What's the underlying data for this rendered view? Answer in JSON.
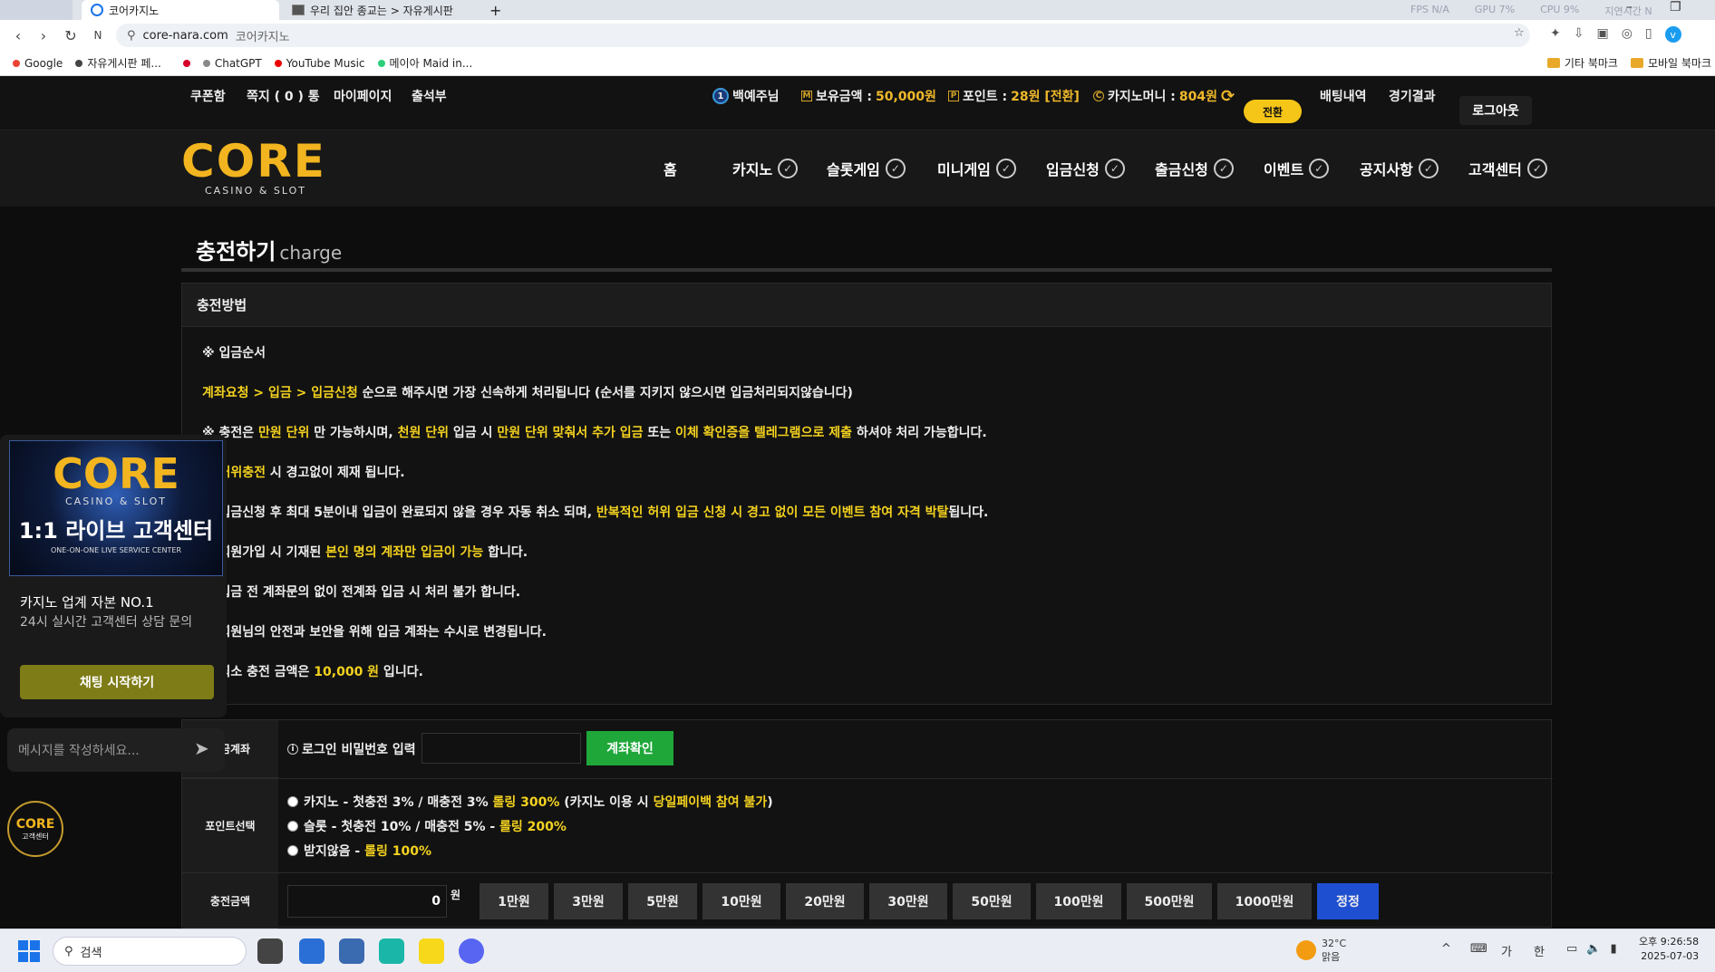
{
  "browser": {
    "tabs": [
      {
        "label": "코어카지노",
        "active": true
      },
      {
        "label": "우리 집안 종교는 > 자유게시판"
      }
    ],
    "new_tab": "+",
    "url": "core-nara.com",
    "url_title": "코어카지노",
    "bookmarks": [
      "Google",
      "자유게시판 페...",
      "ChatGPT",
      "YouTube Music",
      "메이아 Maid in..."
    ],
    "bookmark_folders": [
      "기타 북마크",
      "모바일 북마크"
    ],
    "overlay": {
      "fps": "FPS N/A",
      "gpu": "GPU 7%",
      "cpu": "CPU 9%",
      "latency": "지연시간 N"
    }
  },
  "topbar": {
    "links": [
      "쿠폰함",
      "쪽지 ( 0 ) 통",
      "마이페이지",
      "출석부"
    ],
    "user_level": "1",
    "user_name": "백예주님",
    "balance_label": "보유금액 : ",
    "balance_value": "50,000원",
    "points_label": "포인트 : ",
    "points_value": "28원 [전환]",
    "casino_money_label": "카지노머니 : ",
    "casino_money_value": "804원",
    "swap_button": "전환",
    "bet_history": "배팅내역",
    "match_results": "경기결과",
    "logout": "로그아웃"
  },
  "brand": {
    "logo_text": "CORE",
    "logo_sub": "CASINO & SLOT"
  },
  "nav": {
    "items": [
      "홈",
      "카지노",
      "슬롯게임",
      "미니게임",
      "입금신청",
      "출금신청",
      "이벤트",
      "공지사항",
      "고객센터"
    ]
  },
  "page": {
    "title": "충전하기",
    "title_en": "charge"
  },
  "guide": {
    "header": "충전방법",
    "l1": "※ 입금순서",
    "l2a": "계좌요청 > 입금 > 입금신청",
    "l2b": " 순으로 해주시면 가장 신속하게 처리됩니다 (순서를 지키지 않으시면 입금처리되지않습니다)",
    "l3a": "※ 충전은 ",
    "l3b": "만원 단위",
    "l3c": " 만 가능하시며, ",
    "l3d": "천원 단위",
    "l3e": " 입금 시 ",
    "l3f": "만원 단위 맞춰서 추가 입금",
    "l3g": " 또는 ",
    "l3h": "이체 확인증을 텔레그램으로 제출",
    "l3i": " 하셔야 처리 가능합니다.",
    "l4a": "※ 허위충전",
    "l4b": " 시 경고없이 제재 됩니다.",
    "l5a": "※ 입금신청 후 최대 5분이내 입금이 완료되지 않을 경우 자동 취소 되며, ",
    "l5b": "반복적인 허위 입금 신청 시 경고 없이 모든 이벤트 참여 자격 박탈",
    "l5c": "됩니다.",
    "l6a": "※ 회원가입 시 기재된 ",
    "l6b": "본인 명의 계좌만 입금이 가능",
    "l6c": " 합니다.",
    "l7": "※ 입금 전 계좌문의 없이 전계좌 입금 시 처리 불가 합니다.",
    "l8": "※ 회원님의 안전과 보안을 위해 입금 계좌는 수시로 변경됩니다.",
    "l9a": "※ 최소 충전 금액은 ",
    "l9b": "10,000 원",
    "l9c": " 입니다."
  },
  "form": {
    "account_label": "입금계좌",
    "pw_label": "로그인 비밀번호 입력",
    "account_button": "계좌확인",
    "point_label": "포인트선택",
    "point_options": [
      {
        "a": "카지노 - 첫충전 3% / 매충전 3% ",
        "b": "롤링 300%",
        "c": " (카지노 이용 시 ",
        "d": "당일페이백 참여 불가",
        "e": ")"
      },
      {
        "a": "슬롯 - 첫충전 10% / 매충전 5% - ",
        "b": "롤링 200%"
      },
      {
        "a": "받지않음 - ",
        "b": "롤링 100%"
      }
    ],
    "amount_label": "충전금액",
    "amount_value": "0",
    "amount_unit": "원",
    "amount_buttons": [
      "1만원",
      "3만원",
      "5만원",
      "10만원",
      "20만원",
      "30만원",
      "50만원",
      "100만원",
      "500만원",
      "1000만원"
    ],
    "reset_button": "정정"
  },
  "chat": {
    "banner_logo": "CORE",
    "banner_sub": "CASINO & SLOT",
    "banner_title": "1:1 라이브 고객센터",
    "banner_en": "ONE-ON-ONE LIVE SERVICE CENTER",
    "headline": "카지노 업계 자본 NO.1",
    "desc": "24시 실시간 고객센터 상담 문의",
    "start_button": "채팅 시작하기",
    "input_placeholder": "메시지를 작성하세요...",
    "fab_logo": "CORE",
    "fab_sub": "고객센터"
  },
  "taskbar": {
    "search": "검색",
    "weather_temp": "32°C",
    "weather_desc": "맑음",
    "ime1": "가",
    "ime2": "한",
    "time": "오후 9:26:58",
    "date": "2025-07-03"
  },
  "colors": {
    "accent_yellow": "#f4d21f",
    "gold": "#f0b92a",
    "green_button": "#1fa73a",
    "blue_button": "#1f4fd1",
    "chat_button": "#7e7c17"
  }
}
